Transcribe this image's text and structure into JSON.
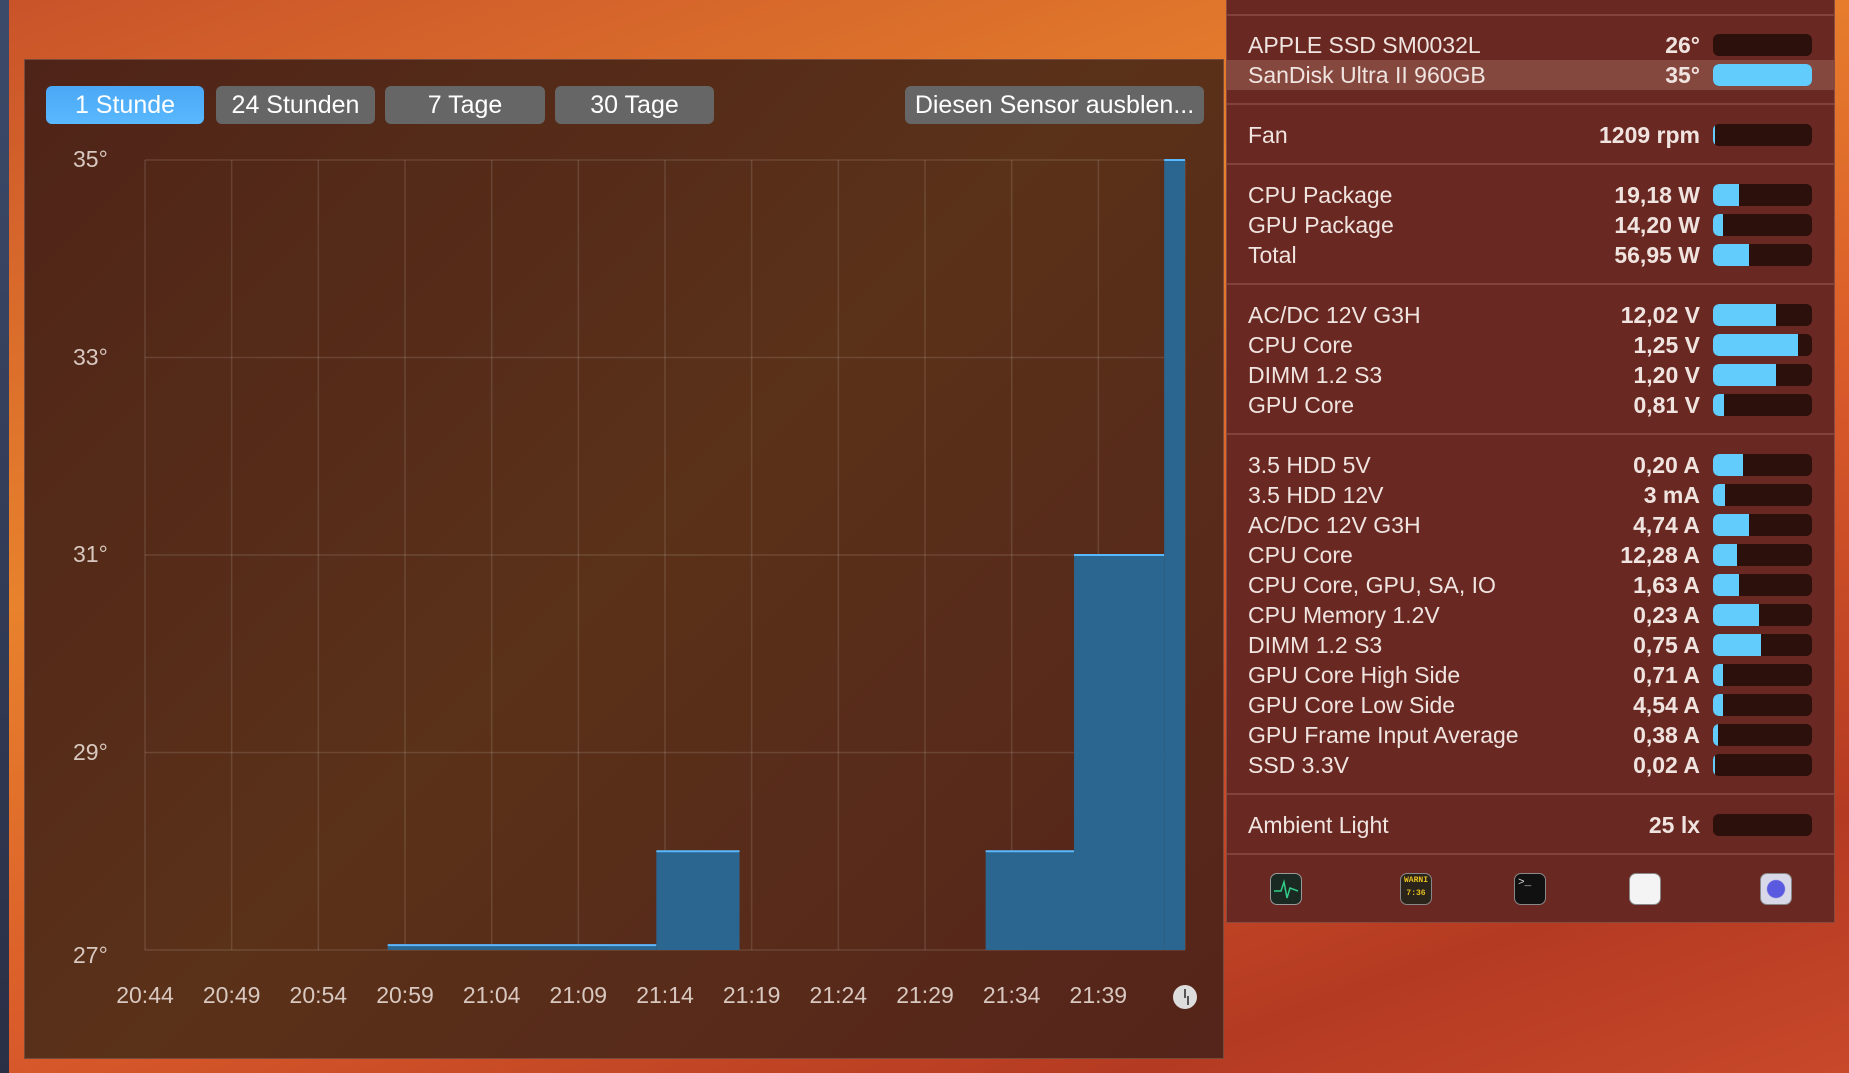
{
  "chart_window": {
    "tabs": [
      {
        "label": "1 Stunde",
        "active": true
      },
      {
        "label": "24 Stunden",
        "active": false
      },
      {
        "label": "7 Tage",
        "active": false
      },
      {
        "label": "30 Tage",
        "active": false
      }
    ],
    "hide_button": "Diesen Sensor ausblen..."
  },
  "chart_data": {
    "type": "area",
    "title": "",
    "xlabel": "",
    "ylabel": "",
    "ylim": [
      27,
      35
    ],
    "y_ticks": [
      "27°",
      "29°",
      "31°",
      "33°",
      "35°"
    ],
    "y_tick_values": [
      27,
      29,
      31,
      33,
      35
    ],
    "x_ticks": [
      "20:44",
      "20:49",
      "20:54",
      "20:59",
      "21:04",
      "21:09",
      "21:14",
      "21:19",
      "21:24",
      "21:29",
      "21:34",
      "21:39"
    ],
    "x_range_minutes": [
      0,
      60
    ],
    "series": [
      {
        "name": "SanDisk Ultra II 960GB",
        "color": "#2b6691",
        "segments": [
          [
            [
              14,
              27.05
            ],
            [
              29.5,
              27.05
            ]
          ],
          [
            [
              29.5,
              28
            ],
            [
              34.3,
              28
            ]
          ],
          [
            [
              48.5,
              28
            ],
            [
              53.6,
              28
            ]
          ],
          [
            [
              53.6,
              31
            ],
            [
              58.8,
              31
            ]
          ],
          [
            [
              58.8,
              35
            ],
            [
              60,
              35
            ]
          ]
        ]
      }
    ],
    "grid": true
  },
  "panel": {
    "groups": [
      [
        {
          "label": "APPLE SSD SM0032L",
          "value": "26°",
          "fill": 0
        },
        {
          "label": "SanDisk Ultra II 960GB",
          "value": "35°",
          "fill": 1,
          "selected": true
        }
      ],
      [
        {
          "label": "Fan",
          "value": "1209 rpm",
          "fill": 0.02
        }
      ],
      [
        {
          "label": "CPU Package",
          "value": "19,18 W",
          "fill": 0.26
        },
        {
          "label": "GPU Package",
          "value": "14,20 W",
          "fill": 0.1
        },
        {
          "label": "Total",
          "value": "56,95 W",
          "fill": 0.36
        }
      ],
      [
        {
          "label": "AC/DC 12V G3H",
          "value": "12,02 V",
          "fill": 0.64
        },
        {
          "label": "CPU Core",
          "value": "1,25 V",
          "fill": 0.86
        },
        {
          "label": "DIMM 1.2 S3",
          "value": "1,20 V",
          "fill": 0.64
        },
        {
          "label": "GPU Core",
          "value": "0,81 V",
          "fill": 0.11
        }
      ],
      [
        {
          "label": "3.5 HDD 5V",
          "value": "0,20 A",
          "fill": 0.3
        },
        {
          "label": "3.5 HDD 12V",
          "value": "3 mA",
          "fill": 0.12
        },
        {
          "label": "AC/DC 12V G3H",
          "value": "4,74 A",
          "fill": 0.36
        },
        {
          "label": "CPU Core",
          "value": "12,28 A",
          "fill": 0.24
        },
        {
          "label": "CPU Core, GPU, SA, IO",
          "value": "1,63 A",
          "fill": 0.26
        },
        {
          "label": "CPU Memory 1.2V",
          "value": "0,23 A",
          "fill": 0.46
        },
        {
          "label": "DIMM 1.2 S3",
          "value": "0,75 A",
          "fill": 0.48
        },
        {
          "label": "GPU Core High Side",
          "value": "0,71 A",
          "fill": 0.1
        },
        {
          "label": "GPU Core Low Side",
          "value": "4,54 A",
          "fill": 0.1
        },
        {
          "label": "GPU Frame Input Average",
          "value": "0,38 A",
          "fill": 0.05
        },
        {
          "label": "SSD 3.3V",
          "value": "0,02 A",
          "fill": 0.02
        }
      ],
      [
        {
          "label": "Ambient Light",
          "value": "25 lx",
          "fill": 0
        }
      ]
    ],
    "apps": [
      "activity-monitor",
      "console",
      "terminal",
      "system-information",
      "istat"
    ],
    "console_icon_text": "WARNI 7:36"
  },
  "colors": {
    "accent": "#62cdfc",
    "area": "#2b6691",
    "area_line": "#5ab8ff"
  }
}
